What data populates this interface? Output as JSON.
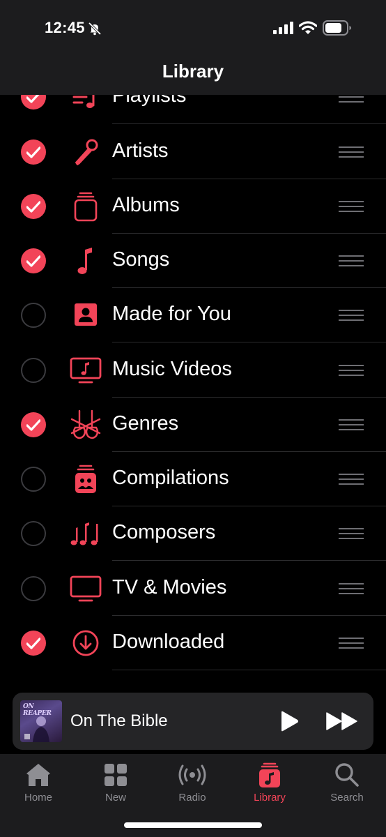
{
  "status_bar": {
    "time": "12:45"
  },
  "nav": {
    "title": "Library"
  },
  "items": [
    {
      "label": "Playlists",
      "checked": true,
      "icon": "playlist-icon"
    },
    {
      "label": "Artists",
      "checked": true,
      "icon": "microphone-icon"
    },
    {
      "label": "Albums",
      "checked": true,
      "icon": "album-stack-icon"
    },
    {
      "label": "Songs",
      "checked": true,
      "icon": "music-note-icon"
    },
    {
      "label": "Made for You",
      "checked": false,
      "icon": "person-square-icon"
    },
    {
      "label": "Music Videos",
      "checked": false,
      "icon": "tv-music-icon"
    },
    {
      "label": "Genres",
      "checked": true,
      "icon": "guitars-icon"
    },
    {
      "label": "Compilations",
      "checked": false,
      "icon": "compilation-stack-icon"
    },
    {
      "label": "Composers",
      "checked": false,
      "icon": "music-notes-icon"
    },
    {
      "label": "TV & Movies",
      "checked": false,
      "icon": "tv-icon"
    },
    {
      "label": "Downloaded",
      "checked": true,
      "icon": "download-circle-icon"
    }
  ],
  "now_playing": {
    "title": "On The Bible",
    "artwork_text": "ON REAPER"
  },
  "tabs": [
    {
      "label": "Home",
      "icon": "home-icon",
      "active": false
    },
    {
      "label": "New",
      "icon": "grid-icon",
      "active": false
    },
    {
      "label": "Radio",
      "icon": "radio-waves-icon",
      "active": false
    },
    {
      "label": "Library",
      "icon": "library-icon",
      "active": true
    },
    {
      "label": "Search",
      "icon": "magnifier-icon",
      "active": false
    }
  ],
  "colors": {
    "accent": "#f24458",
    "background": "#000000",
    "bar": "#1c1c1e",
    "inactive": "#8e8e93"
  }
}
